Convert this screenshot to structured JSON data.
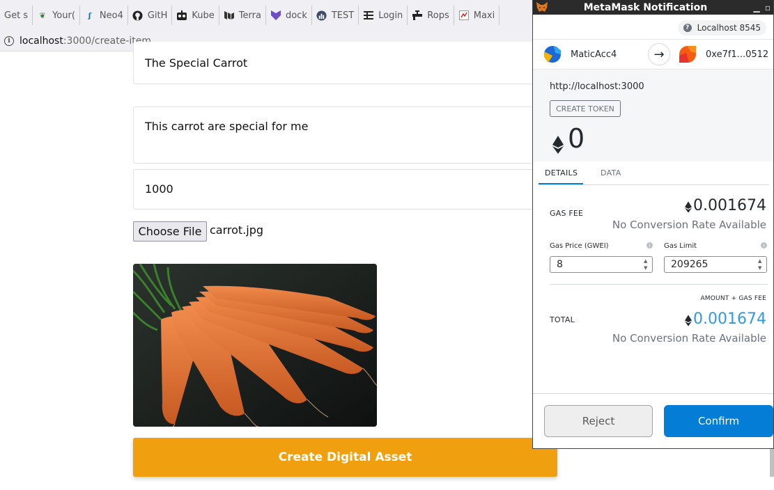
{
  "browser": {
    "bookmarks": [
      {
        "label": "Get s",
        "icon": "page-icon"
      },
      {
        "label": "Your(",
        "icon": "leaf-icon"
      },
      {
        "label": "Neo4",
        "icon": "neo4j-icon"
      },
      {
        "label": "GitH",
        "icon": "github-icon"
      },
      {
        "label": "Kube",
        "icon": "robot-icon"
      },
      {
        "label": "Terra",
        "icon": "terraform-icon"
      },
      {
        "label": "dock",
        "icon": "docker-icon"
      },
      {
        "label": "TEST",
        "icon": "chart-icon"
      },
      {
        "label": "Login",
        "icon": "login-icon"
      },
      {
        "label": "Rops",
        "icon": "faucet-icon"
      },
      {
        "label": "Maxi",
        "icon": "map-icon"
      }
    ],
    "url": {
      "host": "localhost",
      "path": ":3000/create-item"
    }
  },
  "form": {
    "name_value": "The Special Carrot",
    "description_value": "This carrot are special for me",
    "price_value": "1000",
    "choose_file_label": "Choose File",
    "file_name": "carrot.jpg",
    "submit_label": "Create Digital Asset"
  },
  "metamask": {
    "window_title": "MetaMask Notification",
    "network": "Localhost 8545",
    "from_account": "MaticAcc4",
    "to_account": "0xe7f1...0512",
    "origin": "http://localhost:3000",
    "method": "CREATE TOKEN",
    "amount": "0",
    "tabs": {
      "details": "DETAILS",
      "data": "DATA"
    },
    "gas_fee_label": "GAS FEE",
    "gas_fee_value": "0.001674",
    "no_conversion": "No Conversion Rate Available",
    "gas_price_label": "Gas Price (GWEI)",
    "gas_price_value": "8",
    "gas_limit_label": "Gas Limit",
    "gas_limit_value": "209265",
    "amount_gas_fee_label": "AMOUNT + GAS FEE",
    "total_label": "TOTAL",
    "total_value": "0.001674",
    "reject_label": "Reject",
    "confirm_label": "Confirm",
    "colors": {
      "primary": "#037dd6",
      "total_value": "#2f9ae0",
      "orange_button": "#f0a00e"
    }
  }
}
